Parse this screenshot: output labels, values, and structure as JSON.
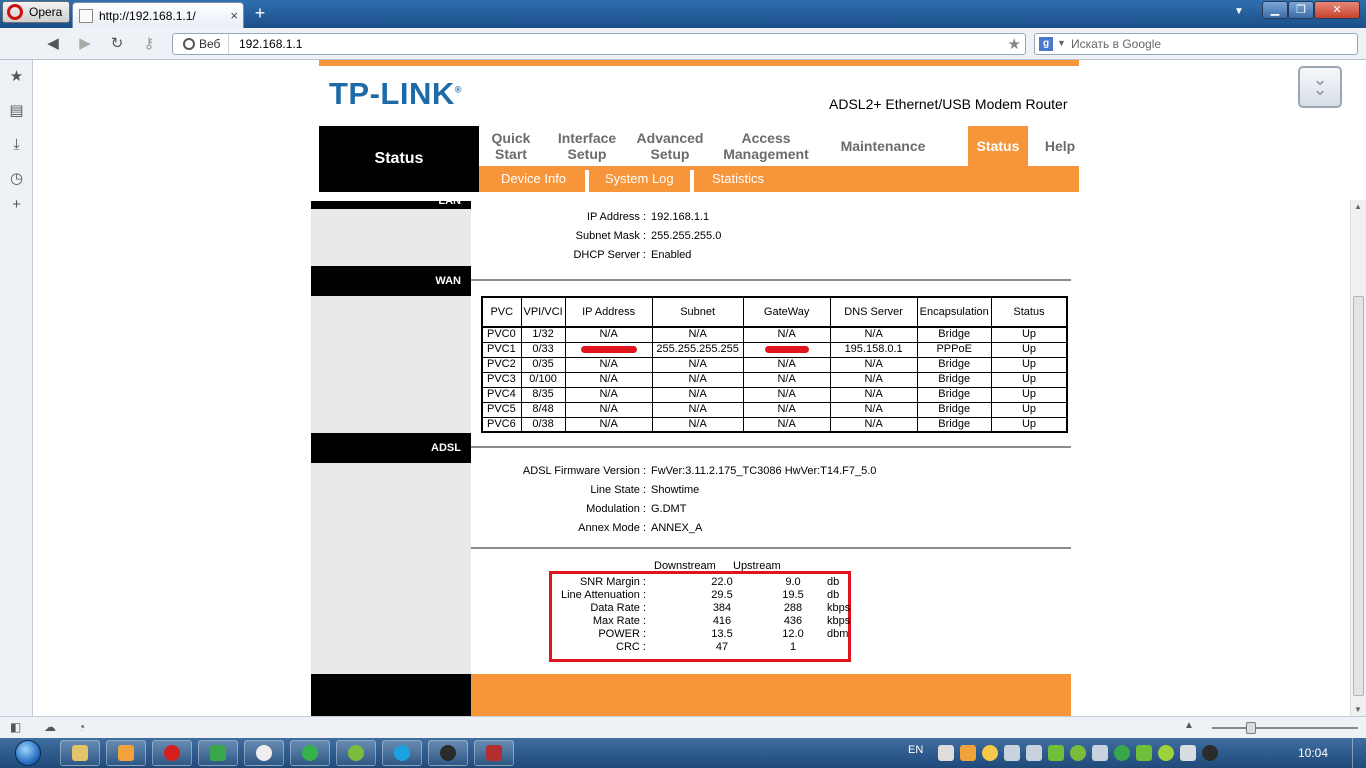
{
  "browser": {
    "menu_label": "Opera",
    "tab_title": "http://192.168.1.1/",
    "address_prefix": "Веб",
    "address": "192.168.1.1",
    "search_placeholder": "Искать в Google",
    "search_engine_icon": "google-icon",
    "tab_close": "×",
    "new_tab": "+"
  },
  "router": {
    "brand": "TP-LINK",
    "brand_mark": "®",
    "product": "ADSL2+ Ethernet/USB Modem Router",
    "section_title": "Status",
    "nav": [
      {
        "label": "Quick Start"
      },
      {
        "label": "Interface Setup"
      },
      {
        "label": "Advanced Setup"
      },
      {
        "label": "Access Management"
      },
      {
        "label": "Maintenance"
      },
      {
        "label": "Status"
      },
      {
        "label": "Help"
      }
    ],
    "subnav": [
      {
        "label": "Device Info"
      },
      {
        "label": "System Log"
      },
      {
        "label": "Statistics"
      }
    ]
  },
  "lan": {
    "head": "LAN",
    "rows": [
      {
        "label": "IP Address :",
        "value": "192.168.1.1"
      },
      {
        "label": "Subnet Mask :",
        "value": "255.255.255.0"
      },
      {
        "label": "DHCP Server :",
        "value": "Enabled"
      }
    ]
  },
  "wan": {
    "head": "WAN",
    "columns": [
      "PVC",
      "VPI/VCI",
      "IP Address",
      "Subnet",
      "GateWay",
      "DNS Server",
      "Encapsulation",
      "Status"
    ],
    "rows": [
      [
        "PVC0",
        "1/32",
        "N/A",
        "N/A",
        "N/A",
        "N/A",
        "Bridge",
        "Up"
      ],
      [
        "PVC1",
        "0/33",
        "",
        "255.255.255.255",
        "",
        "195.158.0.1",
        "PPPoE",
        "Up"
      ],
      [
        "PVC2",
        "0/35",
        "N/A",
        "N/A",
        "N/A",
        "N/A",
        "Bridge",
        "Up"
      ],
      [
        "PVC3",
        "0/100",
        "N/A",
        "N/A",
        "N/A",
        "N/A",
        "Bridge",
        "Up"
      ],
      [
        "PVC4",
        "8/35",
        "N/A",
        "N/A",
        "N/A",
        "N/A",
        "Bridge",
        "Up"
      ],
      [
        "PVC5",
        "8/48",
        "N/A",
        "N/A",
        "N/A",
        "N/A",
        "Bridge",
        "Up"
      ],
      [
        "PVC6",
        "0/38",
        "N/A",
        "N/A",
        "N/A",
        "N/A",
        "Bridge",
        "Up"
      ]
    ]
  },
  "adsl": {
    "head": "ADSL",
    "rows": [
      {
        "label": "ADSL Firmware Version :",
        "value": "FwVer:3.11.2.175_TC3086 HwVer:T14.F7_5.0"
      },
      {
        "label": "Line State :",
        "value": "Showtime"
      },
      {
        "label": "Modulation :",
        "value": "G.DMT"
      },
      {
        "label": "Annex Mode :",
        "value": "ANNEX_A"
      }
    ],
    "stats_headers": {
      "down": "Downstream",
      "up": "Upstream"
    },
    "stats": [
      {
        "label": "SNR Margin :",
        "down": "22.0",
        "up": "9.0",
        "unit": "db"
      },
      {
        "label": "Line Attenuation :",
        "down": "29.5",
        "up": "19.5",
        "unit": "db"
      },
      {
        "label": "Data Rate :",
        "down": "384",
        "up": "288",
        "unit": "kbps"
      },
      {
        "label": "Max Rate :",
        "down": "416",
        "up": "436",
        "unit": "kbps"
      },
      {
        "label": "POWER :",
        "down": "13.5",
        "up": "12.0",
        "unit": "dbm"
      },
      {
        "label": "CRC :",
        "down": "47",
        "up": "1",
        "unit": ""
      }
    ]
  },
  "taskbar": {
    "lang": "EN",
    "clock": "10:04"
  },
  "colors": {
    "accent": "#f7953a",
    "brand": "#1d6aa8",
    "highlight": "#e0141c"
  }
}
